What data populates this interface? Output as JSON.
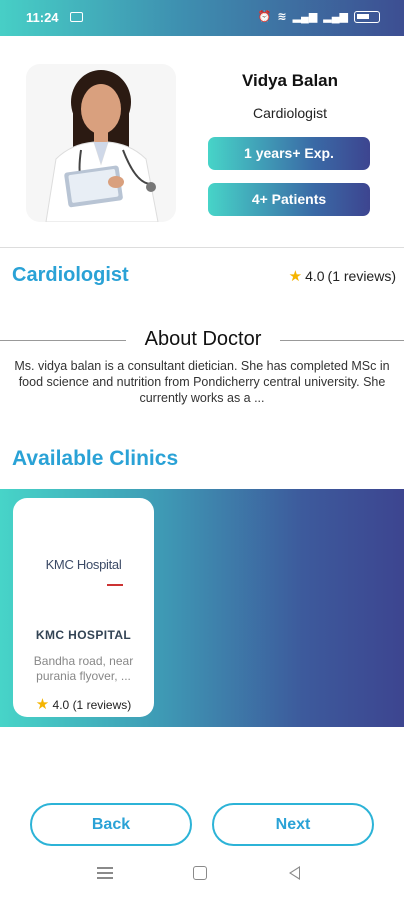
{
  "status_bar": {
    "time": "11:24",
    "icons": [
      "message-icon",
      "alarm-icon",
      "wifi-icon",
      "volte-signal-icon",
      "signal-icon",
      "battery-icon"
    ]
  },
  "doctor": {
    "name": "Vidya Balan",
    "specialization": "Cardiologist",
    "experience": "1 years+ Exp.",
    "patients": "4+ Patients"
  },
  "specialty_row": {
    "title": "Cardiologist",
    "rating": "4.0",
    "reviews": "(1 reviews)"
  },
  "about": {
    "title": "About Doctor",
    "text": "Ms. vidya balan is a consultant dietician. She has completed MSc in food science and nutrition from Pondicherry central university. She currently works as a ..."
  },
  "clinics": {
    "title": "Available Clinics",
    "items": [
      {
        "logo_text": "KMC Hospital",
        "name": "KMC HOSPITAL",
        "address": "Bandha road, near purania flyover, ...",
        "rating": "4.0",
        "reviews": "(1 reviews)"
      }
    ]
  },
  "buttons": {
    "back": "Back",
    "next": "Next"
  },
  "colors": {
    "accent": "#2aa2d6",
    "gradient_start": "#47d4c8",
    "gradient_end": "#3d4590",
    "star": "#f5b400"
  }
}
